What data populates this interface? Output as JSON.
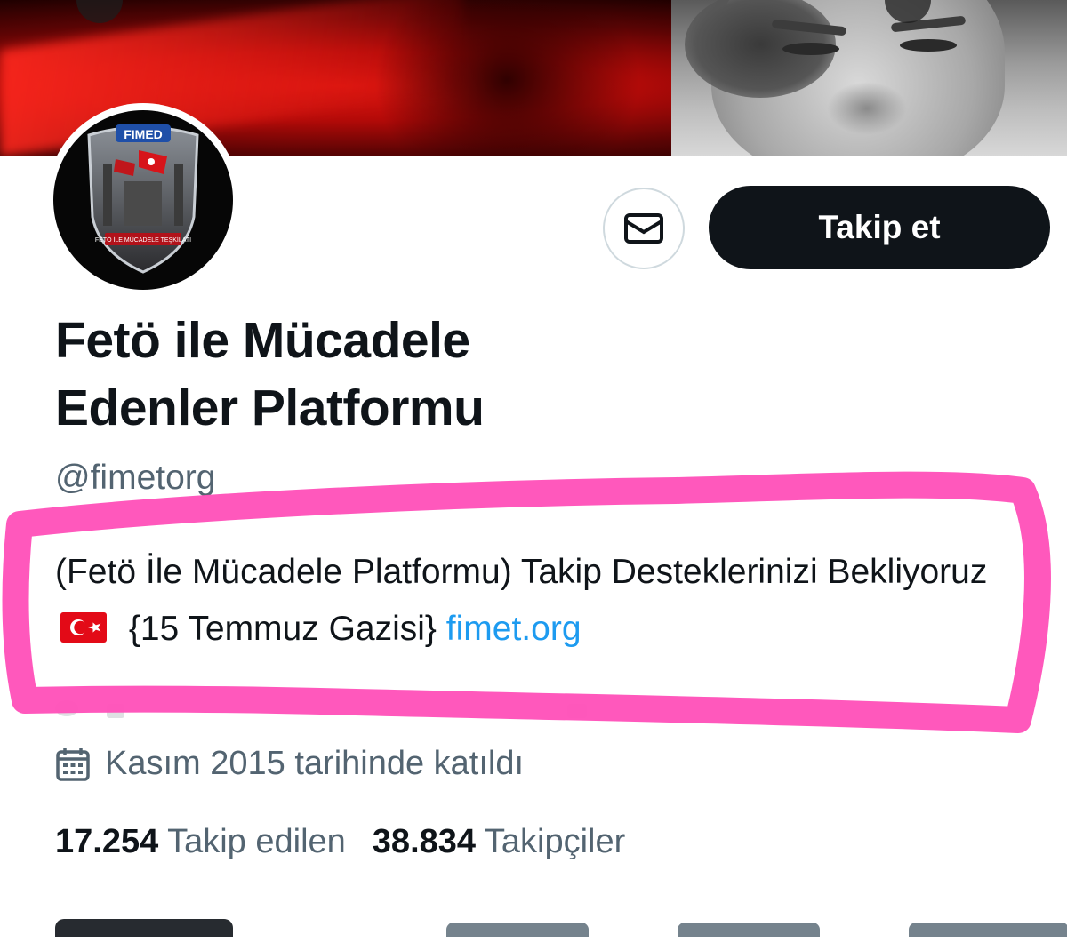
{
  "profile": {
    "display_name_line1": "Fetö ile Mücadele",
    "display_name_line2": "Edenler Platformu",
    "handle": "@fimetorg",
    "bio_text": "(Fetö İle Mücadele Platformu) Takip Desteklerinizi Bekliyoruz",
    "bio_flag": "🇹🇷",
    "bio_suffix": "{15 Temmuz Gazisi}",
    "bio_link": "fimet.org",
    "joined": "Kasım 2015 tarihinde katıldı",
    "avatar_logo_text": "FIMED",
    "avatar_caption": "FETÖ İLE MÜCADELE TEŞKİLATI"
  },
  "actions": {
    "follow_label": "Takip et",
    "message_icon": "envelope-icon"
  },
  "stats": {
    "following_count": "17.254",
    "following_label": "Takip edilen",
    "followers_count": "38.834",
    "followers_label": "Takipçiler"
  },
  "colors": {
    "highlight": "#ff4fb8",
    "link": "#1d9bf0",
    "follow_button": "#0f1419",
    "secondary_text": "#536471"
  }
}
